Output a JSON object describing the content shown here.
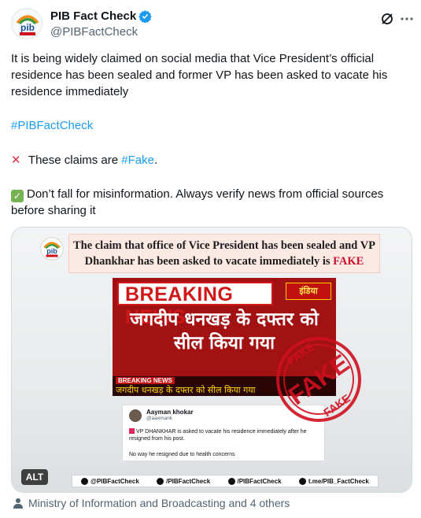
{
  "account": {
    "name": "PIB Fact Check",
    "handle": "@PIBFactCheck",
    "avatar_icon": "pib-logo",
    "verified_color": "#1d9bf0"
  },
  "post": {
    "text_1": "It is being widely claimed on social media that Vice President’s official residence has been sealed and former VP has been asked to vacate his residence immediately",
    "hashtag": "#PIBFactCheck",
    "line_3_prefix": "These claims are ",
    "line_3_hashtag": "#Fake",
    "line_3_suffix": ".",
    "line_4": "Don’t fall for misinformation. Always verify news from official sources before sharing it"
  },
  "media": {
    "alt_label": "ALT",
    "banner_part_1": "The claim that office of Vice President has been sealed and VP Dhankhar has been asked to vacate immediately is ",
    "banner_fake": "FAKE",
    "breaking_news": "BREAKING NEWS",
    "channel_logo": "इंडिया",
    "hindi_headline": "जगदीप धनखड़ के दफ्तर को सील किया गया",
    "strip_label": "BREAKING NEWS",
    "strip_text": "जगदीप धनखड़ के दफ्तर को सील किया गया",
    "embedded_tweet": {
      "name": "Aayman khokar",
      "handle": "@aaxmank",
      "body": "VP DHANKHAR is asked to vacate his residence immediately after he resigned from his post.",
      "body_2": "No way he resigned due to health concerns"
    },
    "stamp_text": "FAKE",
    "stamp_color": "#d0101f",
    "socials": [
      {
        "icon": "x-icon",
        "label": "@PIBFactCheck"
      },
      {
        "icon": "instagram-icon",
        "label": "/PIBFactCheck"
      },
      {
        "icon": "facebook-icon",
        "label": "/PIBFactCheck"
      },
      {
        "icon": "telegram-icon",
        "label": "t.me/PIB_FactCheck"
      }
    ]
  },
  "footer": {
    "tagged": "Ministry of Information and Broadcasting and 4 others"
  }
}
